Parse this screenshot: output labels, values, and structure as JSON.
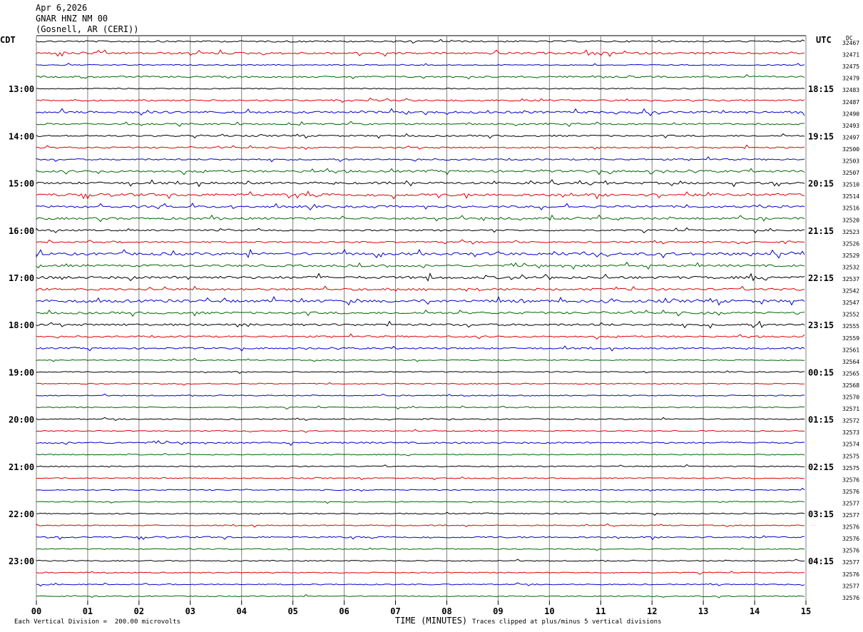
{
  "header": {
    "date": "Apr 6,2026",
    "station": "GNAR HNZ NM 00",
    "location": "(Gosnell, AR (CERI))"
  },
  "left_axis_label": "CDT",
  "right_axis_label": "UTC",
  "dc_label": "DC",
  "footer": {
    "scale": "Each Vertical Division =  200.00 microvolts",
    "clip": "Traces clipped at plus/minus 5 vertical divisions"
  },
  "colors": {
    "black": "#000000",
    "red": "#dd0000",
    "blue": "#0000cc",
    "green": "#006600",
    "grid": "#808080"
  },
  "chart_data": {
    "type": "line",
    "title": "Apr 6,2026 GNAR HNZ NM 00 (Gosnell, AR (CERI))",
    "xlabel": "TIME (MINUTES)",
    "xlim": [
      0,
      15
    ],
    "x_ticks": [
      "00",
      "01",
      "02",
      "03",
      "04",
      "05",
      "06",
      "07",
      "08",
      "09",
      "10",
      "11",
      "12",
      "13",
      "14",
      "15"
    ],
    "rows_per_hour": 4,
    "minutes_per_row": 15,
    "trace_color_cycle": [
      "black",
      "red",
      "blue",
      "green"
    ],
    "left_hour_labels": [
      "13:00",
      "14:00",
      "15:00",
      "16:00",
      "17:00",
      "18:00",
      "19:00",
      "20:00",
      "21:00",
      "22:00",
      "23:00"
    ],
    "right_hour_labels": [
      "18:15",
      "19:15",
      "20:15",
      "21:15",
      "22:15",
      "23:15",
      "00:15",
      "01:15",
      "02:15",
      "03:15",
      "04:15"
    ],
    "dc_values": [
      "32467",
      "32471",
      "32475",
      "32479",
      "32483",
      "32487",
      "32490",
      "32493",
      "32497",
      "32500",
      "32503",
      "32507",
      "32510",
      "32514",
      "32516",
      "32520",
      "32523",
      "32526",
      "32529",
      "32532",
      "32537",
      "32542",
      "32547",
      "32552",
      "32555",
      "32559",
      "32561",
      "32564",
      "32565",
      "32568",
      "32570",
      "32571",
      "32572",
      "32573",
      "32574",
      "32575",
      "32575",
      "32576",
      "32576",
      "32577",
      "32577",
      "32576",
      "32576",
      "32576",
      "32577",
      "32576",
      "32577",
      "32576"
    ],
    "activity_level": [
      2,
      3,
      1,
      2,
      1,
      2,
      3,
      2,
      2,
      2,
      2,
      3,
      3,
      4,
      3,
      3,
      2,
      2,
      4,
      3,
      4,
      3,
      4,
      3,
      3,
      2,
      2,
      1,
      1,
      1,
      1,
      1,
      1,
      1,
      2,
      1,
      1,
      1,
      1,
      1,
      1,
      1,
      2,
      1,
      1,
      1,
      1,
      1
    ],
    "y_unit": "200.00 microvolts per vertical division",
    "clip_divisions": 5
  }
}
